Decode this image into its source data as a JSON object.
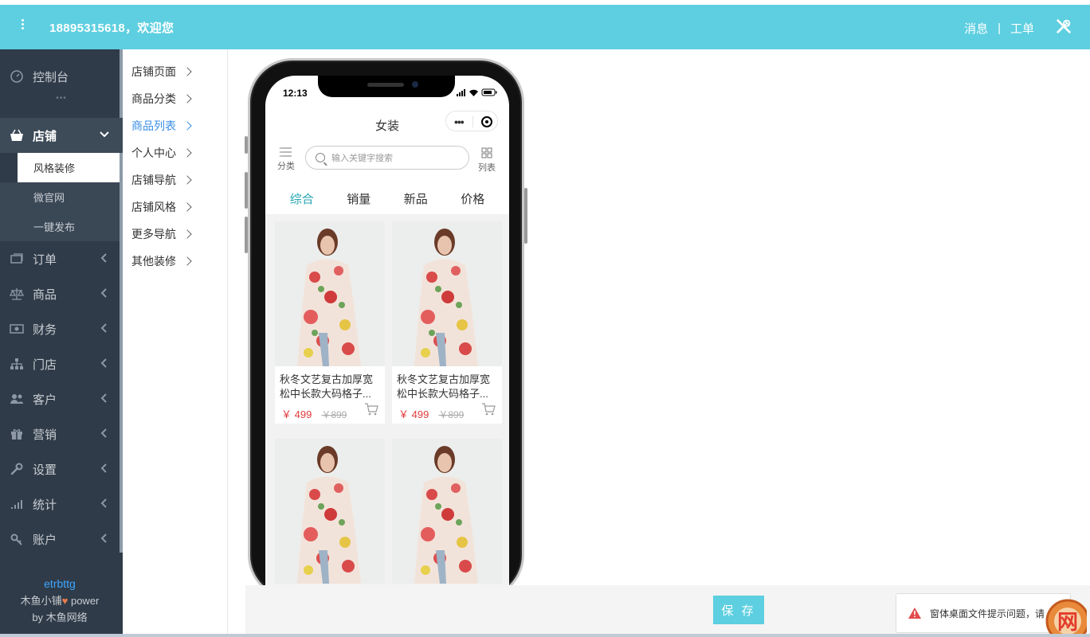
{
  "header": {
    "user_greeting": "18895315618，欢迎您",
    "messages_label": "消息",
    "separator": "|",
    "tickets_label": "工单",
    "accent_color": "#5dcfe0"
  },
  "sidebar": {
    "items": [
      {
        "label": "控制台",
        "icon": "dashboard-icon"
      },
      {
        "label": "店铺",
        "icon": "store-icon",
        "expanded": true
      },
      {
        "label": "订单",
        "icon": "order-icon"
      },
      {
        "label": "商品",
        "icon": "scale-icon"
      },
      {
        "label": "财务",
        "icon": "money-icon"
      },
      {
        "label": "门店",
        "icon": "sitemap-icon"
      },
      {
        "label": "客户",
        "icon": "users-icon"
      },
      {
        "label": "营销",
        "icon": "gift-icon"
      },
      {
        "label": "设置",
        "icon": "wrench-icon"
      },
      {
        "label": "统计",
        "icon": "bar-signal-icon"
      },
      {
        "label": "账户",
        "icon": "key-icon"
      }
    ],
    "dots": "•••",
    "sub_items": [
      "风格装修",
      "微官网",
      "一键发布"
    ],
    "footer": {
      "brand": "etrbttg",
      "line2_prefix": "木鱼小铺",
      "heart": "♥",
      "line2_suffix": "power",
      "line3": "by 木鱼网络"
    }
  },
  "subnav": {
    "items": [
      "店铺页面",
      "商品分类",
      "商品列表",
      "个人中心",
      "店铺导航",
      "店铺风格",
      "更多导航",
      "其他装修"
    ],
    "active_index": 2
  },
  "phone": {
    "time": "12:13",
    "page_title": "女装",
    "capsule_dots": "•••",
    "category_label": "分类",
    "list_label": "列表",
    "search_placeholder": "输入关键字搜索",
    "tabs": [
      "综合",
      "销量",
      "新品",
      "价格"
    ],
    "active_tab": 0,
    "products": [
      {
        "name": "秋冬文艺复古加厚宽松中长款大码格子...",
        "price": "￥ 499",
        "old_price": "￥899"
      },
      {
        "name": "秋冬文艺复古加厚宽松中长款大码格子...",
        "price": "￥ 499",
        "old_price": "￥899"
      },
      {
        "name": "",
        "price": "",
        "old_price": ""
      },
      {
        "name": "",
        "price": "",
        "old_price": ""
      }
    ]
  },
  "savebar": {
    "save_label": "保 存",
    "toast_text": "窗体桌面文件提示问题，请"
  },
  "watermark": {
    "text": "网"
  }
}
